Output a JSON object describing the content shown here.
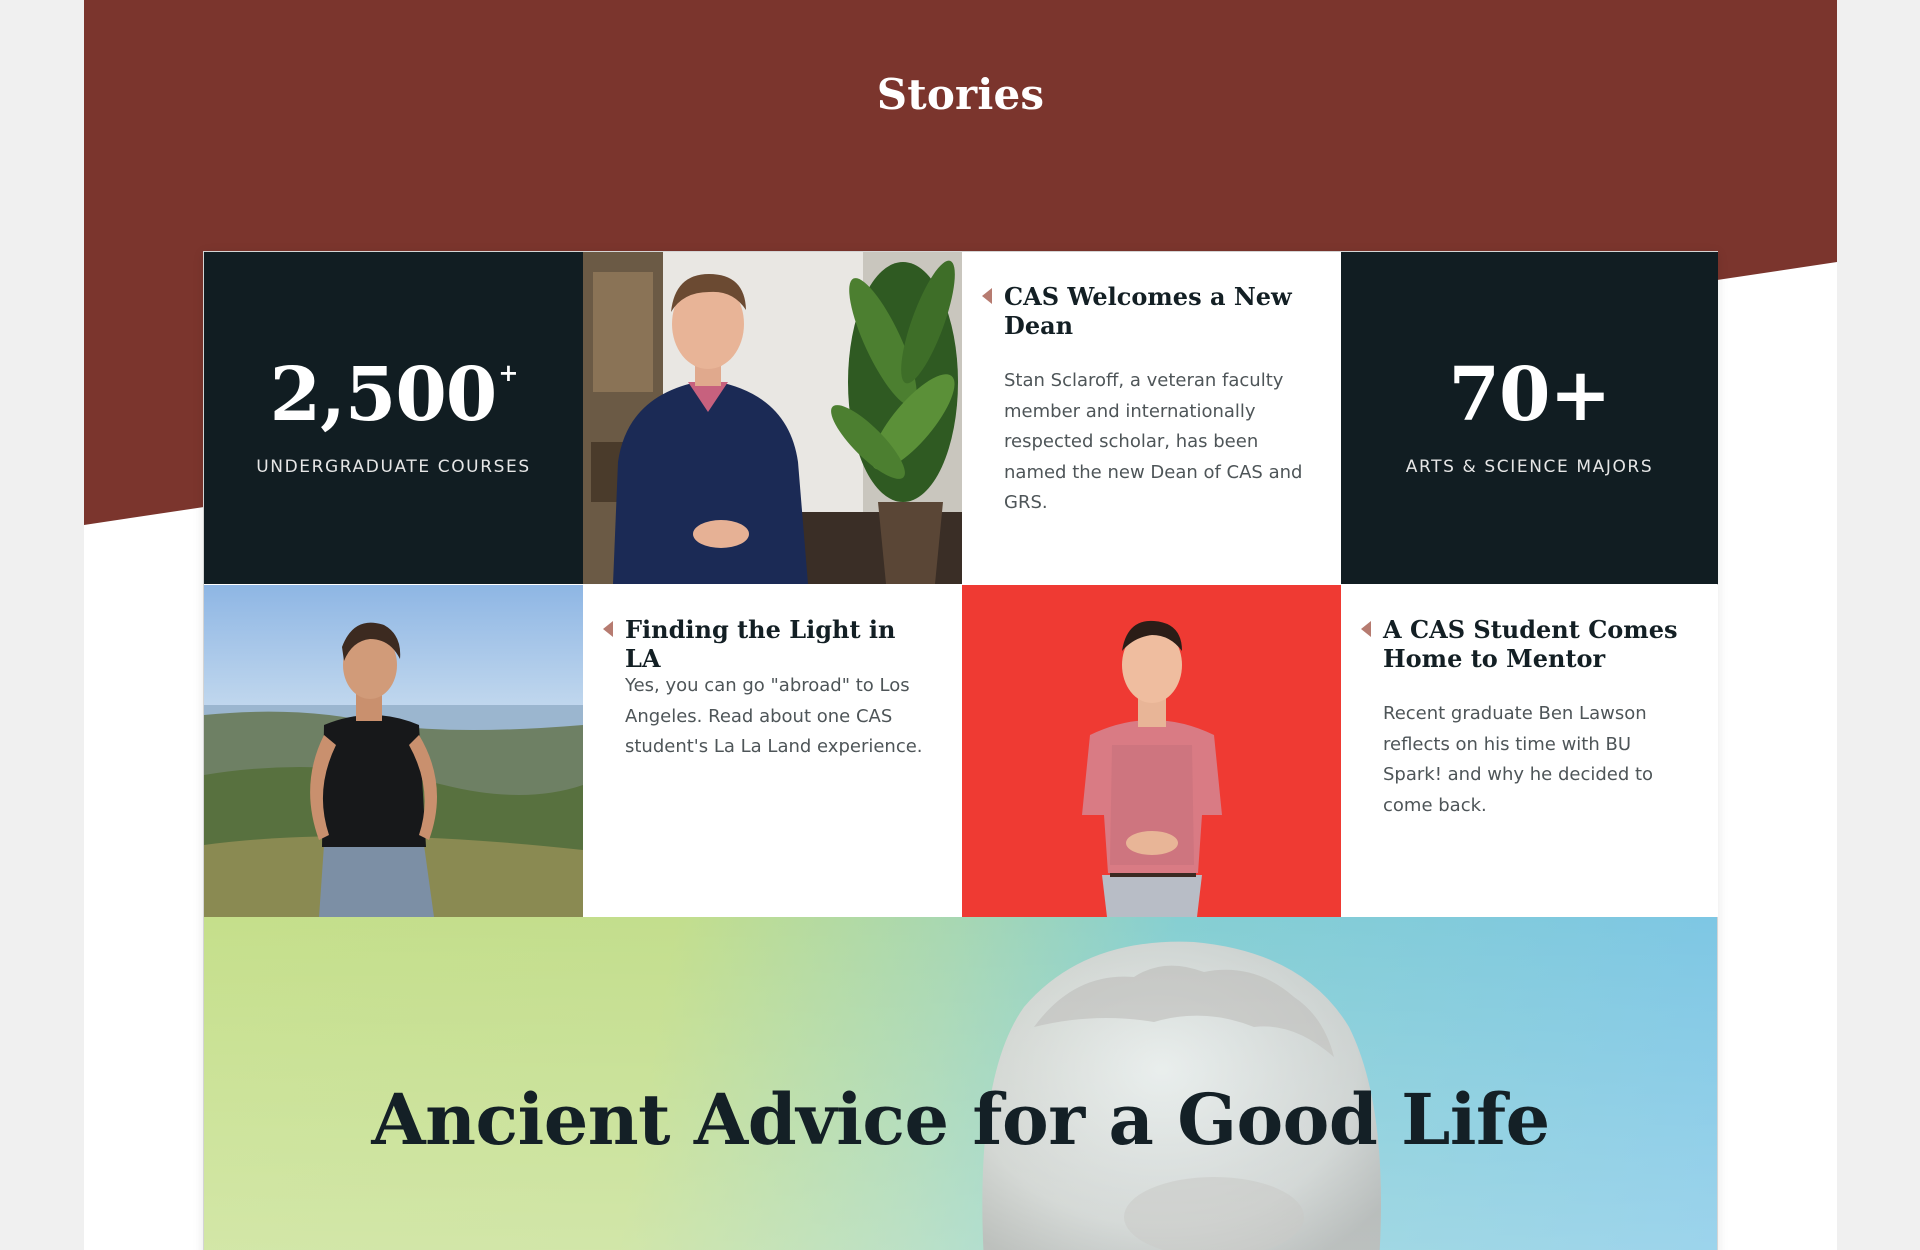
{
  "section": {
    "title": "Stories"
  },
  "colors": {
    "band": "#7b352d",
    "stat_bg": "#111d22",
    "accent_arrow": "#b67b70",
    "feature_gradient_start": "#c5df8b",
    "feature_gradient_end": "#7dc6e6"
  },
  "stats": [
    {
      "number": "2,500",
      "suffix": "+",
      "label": "UNDERGRADUATE COURSES"
    },
    {
      "number": "70+",
      "suffix": "",
      "label": "ARTS & SCIENCE MAJORS"
    }
  ],
  "stories": [
    {
      "title": "CAS Welcomes a New Dean",
      "body": "Stan Sclaroff, a veteran faculty member and internationally respected scholar, has been named the new Dean of CAS and GRS.",
      "icon": "caret-left-icon"
    },
    {
      "title": "Finding the Light in LA",
      "body": "Yes, you can go \"abroad\" to Los Angeles. Read about one CAS student's La La Land experience.",
      "icon": "caret-left-icon"
    },
    {
      "title": "A CAS Student Comes Home to Mentor",
      "body": "Recent graduate Ben Lawson reflects on his time with BU Spark! and why he decided to come back.",
      "icon": "caret-left-icon"
    }
  ],
  "photos": [
    {
      "subject": "dean-portrait"
    },
    {
      "subject": "student-hillside-los-angeles"
    },
    {
      "subject": "student-red-backdrop"
    }
  ],
  "feature": {
    "title": "Ancient Advice for a Good Life"
  }
}
